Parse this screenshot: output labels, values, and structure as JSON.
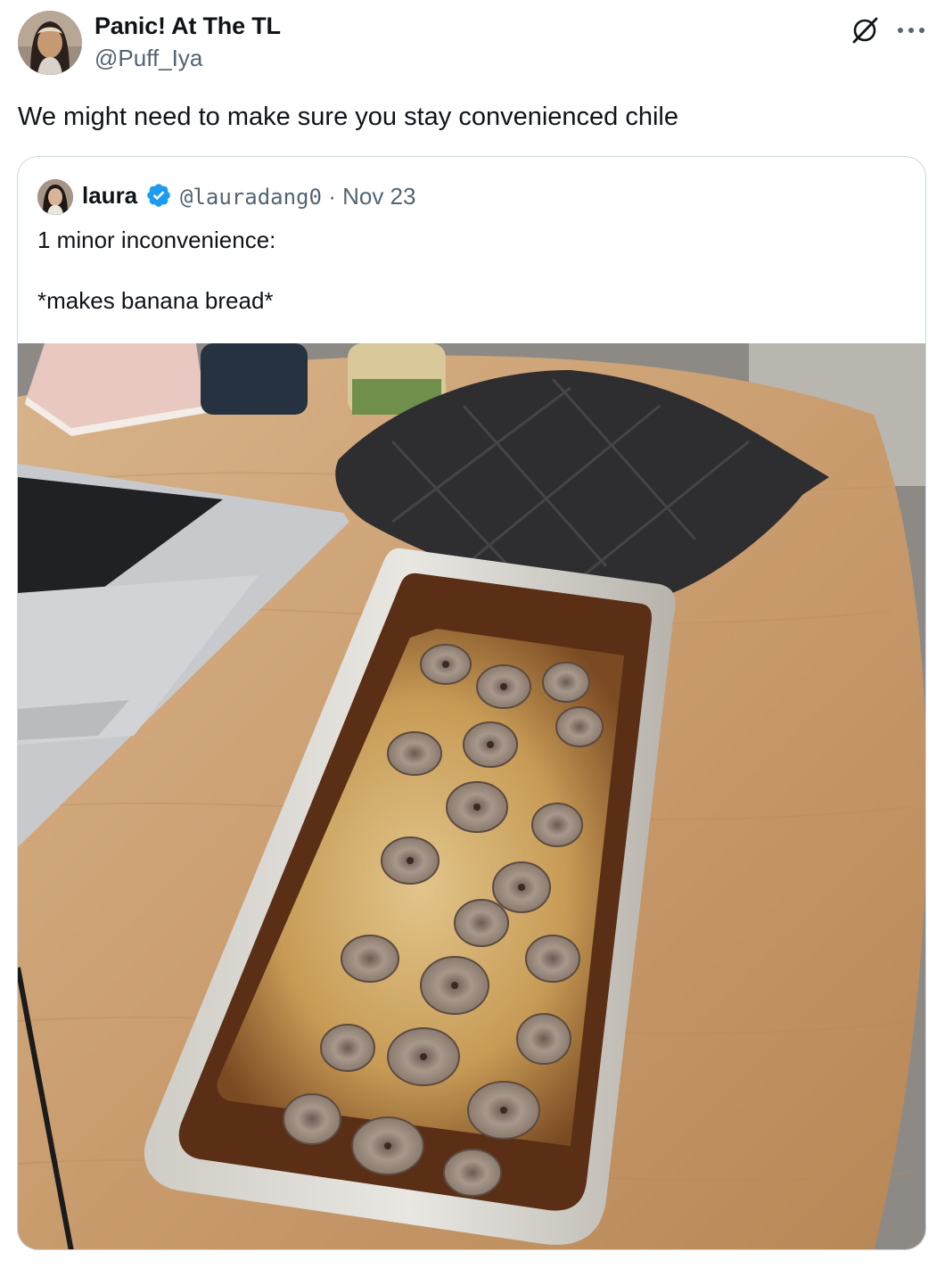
{
  "tweet": {
    "display_name": "Panic! At The TL",
    "handle": "@Puff_Iya",
    "text": "We might need to make sure you stay convenienced chile",
    "icons": {
      "grok": "grok-icon",
      "more": "more-icon",
      "avatar": "avatar"
    }
  },
  "quote": {
    "display_name": "laura",
    "verified": true,
    "handle": "@lauradang0",
    "separator": "·",
    "date": "Nov 23",
    "text": "1 minor inconvenience:\n\n*makes banana bread*",
    "photo_description_icon": "photo",
    "colors": {
      "verified": "#1d9bf0",
      "border": "#cfd9de",
      "secondary_text": "#536471"
    }
  }
}
